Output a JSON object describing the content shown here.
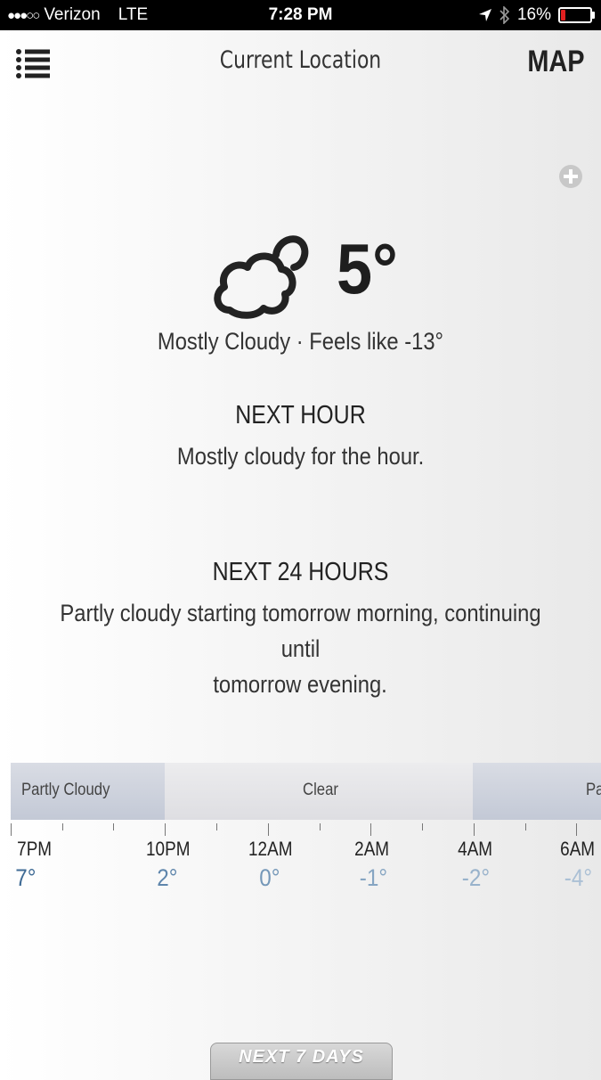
{
  "status_bar": {
    "signal_dots": "●●●○○",
    "carrier": "Verizon",
    "network": "LTE",
    "time": "7:28 PM",
    "battery_percent": "16%",
    "battery_level": 0.16,
    "icons": [
      "location-arrow-icon",
      "bluetooth-icon",
      "battery-icon"
    ]
  },
  "header": {
    "title": "Current Location",
    "map_label": "MAP"
  },
  "current": {
    "temperature": "5°",
    "summary": "Mostly Cloudy · Feels like -13°",
    "icon": "mostly-cloudy-icon"
  },
  "next_hour": {
    "title": "NEXT HOUR",
    "text": "Mostly cloudy for the hour."
  },
  "next_24": {
    "title": "NEXT 24 HOURS",
    "text_line1": "Partly cloudy starting tomorrow morning, continuing until",
    "text_line2": "tomorrow evening."
  },
  "timeline": {
    "bands": [
      {
        "label": "Partly Cloudy",
        "kind": "cloudy"
      },
      {
        "label": "Clear",
        "kind": "clear"
      },
      {
        "label": "Pa",
        "kind": "cloudy"
      }
    ],
    "hours": [
      {
        "time": "7PM",
        "temp": "7°",
        "color": "#3f6b95"
      },
      {
        "time": "10PM",
        "temp": "2°",
        "color": "#5f86ac"
      },
      {
        "time": "12AM",
        "temp": "0°",
        "color": "#7497b8"
      },
      {
        "time": "2AM",
        "temp": "-1°",
        "color": "#86a5c2"
      },
      {
        "time": "4AM",
        "temp": "-2°",
        "color": "#98b2cb"
      },
      {
        "time": "6AM",
        "temp": "-4°",
        "color": "#abc0d5"
      }
    ]
  },
  "footer": {
    "next7_label": "NEXT 7 DAYS"
  }
}
